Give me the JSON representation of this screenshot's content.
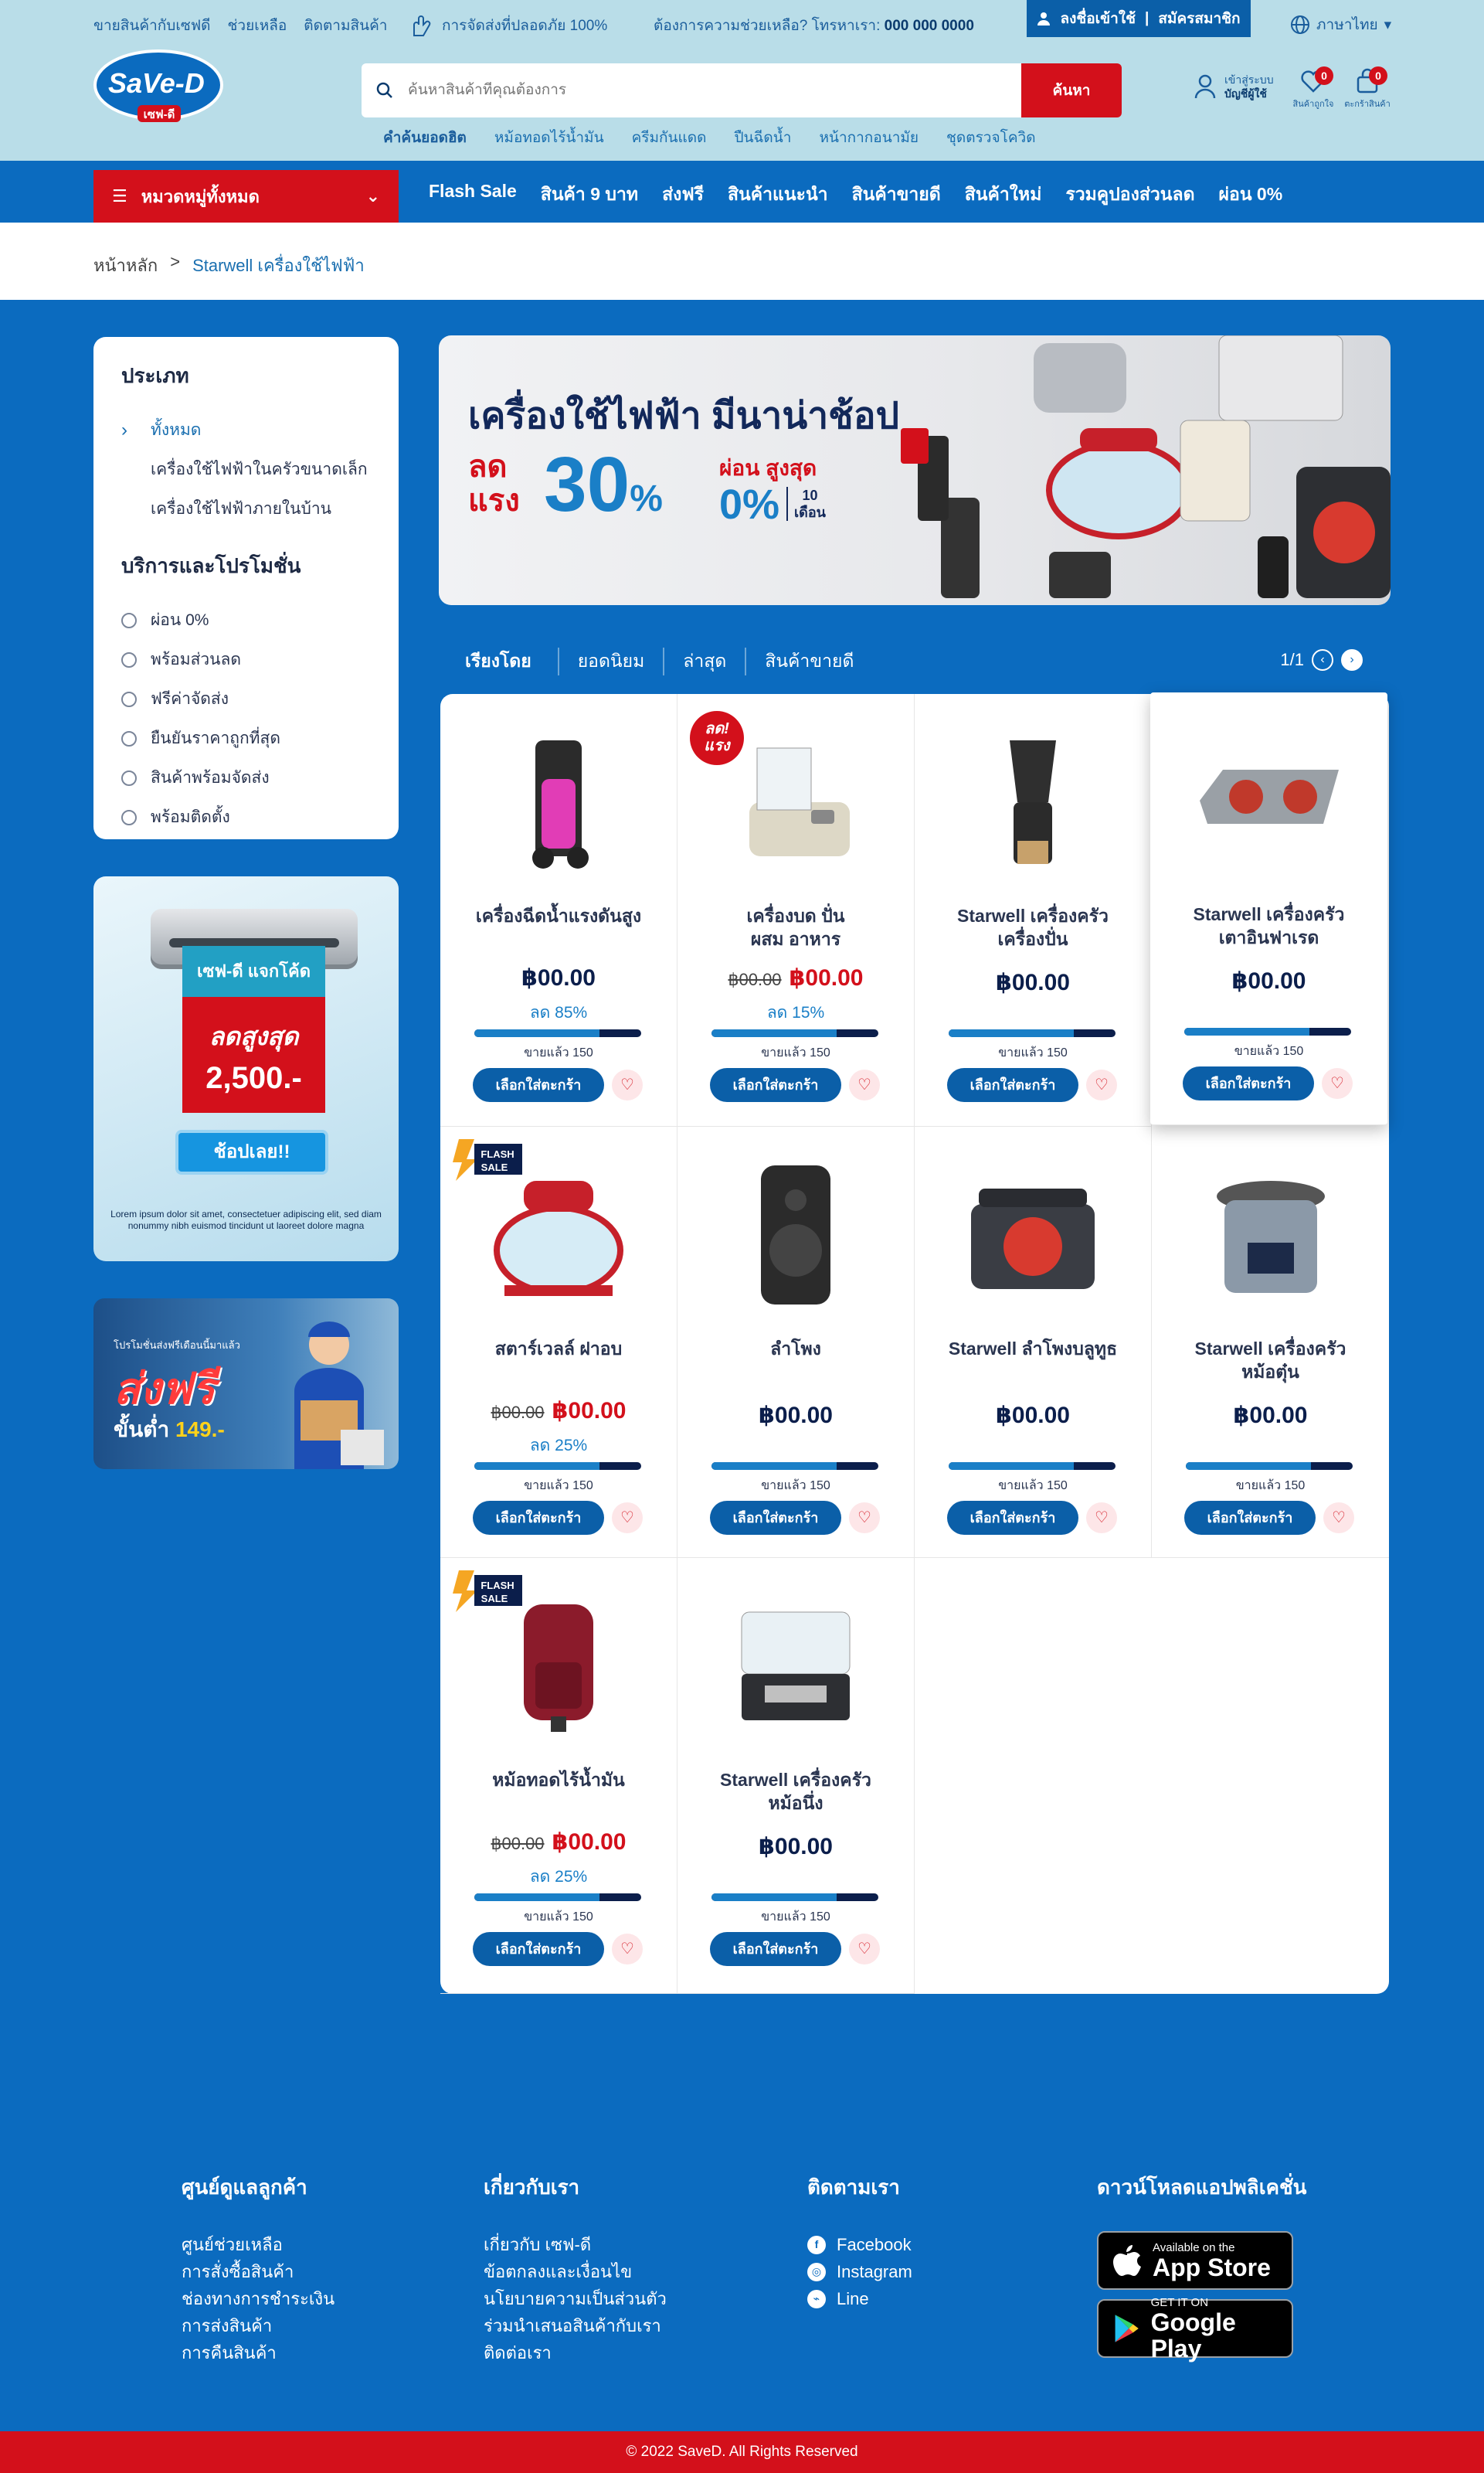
{
  "util": {
    "links": [
      "ขายสินค้ากับเซฟดี",
      "ช่วยเหลือ",
      "ติดตามสินค้า"
    ],
    "safe_text": "การจัดส่งที่ปลอดภัย 100%",
    "help_text": "ต้องการความช่วยเหลือ? โทรหาเรา:",
    "help_phone": "000 000 0000",
    "login": "ลงชื่อเข้าใช้",
    "register": "สมัครสมาชิก",
    "language": "ภาษาไทย"
  },
  "logo": {
    "text": "SaVe-D",
    "sub": "เซฟ-ดี"
  },
  "search": {
    "placeholder": "ค้นหาสินค้าที่คุณต้องการ",
    "button": "ค้นหา"
  },
  "popular": {
    "label": "คำค้นยอดฮิต",
    "terms": [
      "หม้อทอดไร้น้ำมัน",
      "ครีมกันแดด",
      "ปืนฉีดน้ำ",
      "หน้ากากอนามัย",
      "ชุดตรวจโควิด"
    ]
  },
  "account": {
    "line1": "เข้าสู่ระบบ",
    "line2": "บัญชีผู้ใช้"
  },
  "wishlist": {
    "label": "สินค้าถูกใจ",
    "count": "0"
  },
  "cart": {
    "label": "ตะกร้าสินค้า",
    "count": "0"
  },
  "nav": {
    "category_button": "หมวดหมู่ทั้งหมด",
    "links": [
      "Flash Sale",
      "สินค้า 9 บาท",
      "ส่งฟรี",
      "สินค้าแนะนำ",
      "สินค้าขายดี",
      "สินค้าใหม่",
      "รวมคูปองส่วนลด",
      "ผ่อน 0%"
    ]
  },
  "breadcrumb": {
    "home": "หน้าหลัก",
    "sep": ">",
    "current": "Starwell เครื่องใช้ไฟฟ้า"
  },
  "filter": {
    "type_title": "ประเภท",
    "types": [
      "ทั้งหมด",
      "เครื่องใช้ไฟฟ้าในครัวขนาดเล็ก",
      "เครื่องใช้ไฟฟ้าภายในบ้าน"
    ],
    "service_title": "บริการและโปรโมชั่น",
    "services": [
      "ผ่อน 0%",
      "พร้อมส่วนลด",
      "ฟรีค่าจัดส่ง",
      "ยืนยันราคาถูกที่สุด",
      "สินค้าพร้อมจัดส่ง",
      "พร้อมติดตั้ง"
    ]
  },
  "coupon": {
    "top": "เซฟ-ดี แจกโค้ด",
    "line1": "ลดสูงสุด",
    "line2": "2,500.-",
    "button": "ช้อปเลย!!",
    "lorem": "Lorem ipsum dolor sit amet, consectetuer adipiscing elit, sed diam nonummy nibh euismod tincidunt ut laoreet dolore magna"
  },
  "ship_banner": {
    "small": "โปรโมชั่นส่งฟรีเดือนนี้มาแล้ว",
    "big": "ส่งฟรี",
    "min_label": "ขั้นต่ำ",
    "min_value": "149.-"
  },
  "hero": {
    "title": "เครื่องใช้ไฟฟ้า มีนาน่าช้อป",
    "left_label": "ลด\nแรง",
    "percent": "30",
    "percent_sign": "%",
    "installment_label": "ผ่อน สูงสุด",
    "installment_value": "0%",
    "months": "10\nเดือน"
  },
  "sort": {
    "label": "เรียงโดย",
    "options": [
      "ยอดนิยม",
      "ล่าสุด",
      "สินค้าขายดี"
    ],
    "page": "1/1"
  },
  "products": [
    {
      "name": "เครื่องฉีดน้ำแรงดันสูง",
      "price": "฿00.00",
      "old_price": "",
      "discount": "ลด 85%",
      "sold": "ขายแล้ว 150",
      "sold_fraction": 0.75,
      "tag": "",
      "icon": "pressure-washer"
    },
    {
      "name": "เครื่องบด ปั่น\nผสม อาหาร",
      "price": "฿00.00",
      "old_price": "฿00.00",
      "discount": "ลด 15%",
      "sold": "ขายแล้ว 150",
      "sold_fraction": 0.75,
      "tag": "ลด!\nแรง",
      "icon": "food-processor"
    },
    {
      "name": "Starwell เครื่องครัว\nเครื่องปั่น",
      "price": "฿00.00",
      "old_price": "",
      "discount": "",
      "sold": "ขายแล้ว 150",
      "sold_fraction": 0.75,
      "tag": "",
      "icon": "blender"
    },
    {
      "name": "Starwell เครื่องครัว\nเตาอินฟาเรด",
      "price": "฿00.00",
      "old_price": "",
      "discount": "",
      "sold": "ขายแล้ว 150",
      "sold_fraction": 0.75,
      "tag": "",
      "icon": "infrared-stove"
    },
    {
      "name": "สตาร์เวลล์ ฝาอบ",
      "price": "฿00.00",
      "old_price": "฿00.00",
      "discount": "ลด 25%",
      "sold": "ขายแล้ว 150",
      "sold_fraction": 0.75,
      "tag": "FLASH\nSALE",
      "icon": "halogen-oven"
    },
    {
      "name": "ลำโพง",
      "price": "฿00.00",
      "old_price": "",
      "discount": "",
      "sold": "ขายแล้ว 150",
      "sold_fraction": 0.75,
      "tag": "",
      "icon": "speaker"
    },
    {
      "name": "Starwell ลำโพงบลูทูธ",
      "price": "฿00.00",
      "old_price": "",
      "discount": "",
      "sold": "ขายแล้ว 150",
      "sold_fraction": 0.75,
      "tag": "",
      "icon": "bluetooth-speaker"
    },
    {
      "name": "Starwell เครื่องครัว\nหม้อตุ๋น",
      "price": "฿00.00",
      "old_price": "",
      "discount": "",
      "sold": "ขายแล้ว 150",
      "sold_fraction": 0.75,
      "tag": "",
      "icon": "pressure-cooker"
    },
    {
      "name": "หม้อทอดไร้น้ำมัน",
      "price": "฿00.00",
      "old_price": "฿00.00",
      "discount": "ลด 25%",
      "sold": "ขายแล้ว 150",
      "sold_fraction": 0.75,
      "tag": "FLASH\nSALE",
      "icon": "air-fryer"
    },
    {
      "name": "Starwell เครื่องครัว\nหม้อนึ่ง",
      "price": "฿00.00",
      "old_price": "",
      "discount": "",
      "sold": "ขายแล้ว 150",
      "sold_fraction": 0.75,
      "tag": "",
      "icon": "steamer"
    }
  ],
  "card_cart_label": "เลือกใส่ตะกร้า",
  "footer": {
    "care_title": "ศูนย์ดูแลลูกค้า",
    "care_links": [
      "ศูนย์ช่วยเหลือ",
      "การสั่งซื้อสินค้า",
      "ช่องทางการชำระเงิน",
      "การส่งสินค้า",
      "การคืนสินค้า"
    ],
    "about_title": "เกี่ยวกับเรา",
    "about_links": [
      "เกี่ยวกับ เซฟ-ดี",
      "ข้อตกลงและเงื่อนไข",
      "นโยบายความเป็นส่วนตัว",
      "ร่วมนำเสนอสินค้ากับเรา",
      "ติดต่อเรา"
    ],
    "follow_title": "ติดตามเรา",
    "social": [
      "Facebook",
      "Instagram",
      "Line"
    ],
    "app_title": "ดาวน์โหลดแอปพลิเคชั่น",
    "appstore_small": "Available on the",
    "appstore_big": "App Store",
    "gplay_small": "GET IT ON",
    "gplay_big": "Google Play"
  },
  "copyright": "© 2022 SaveD. All Rights Reserved"
}
